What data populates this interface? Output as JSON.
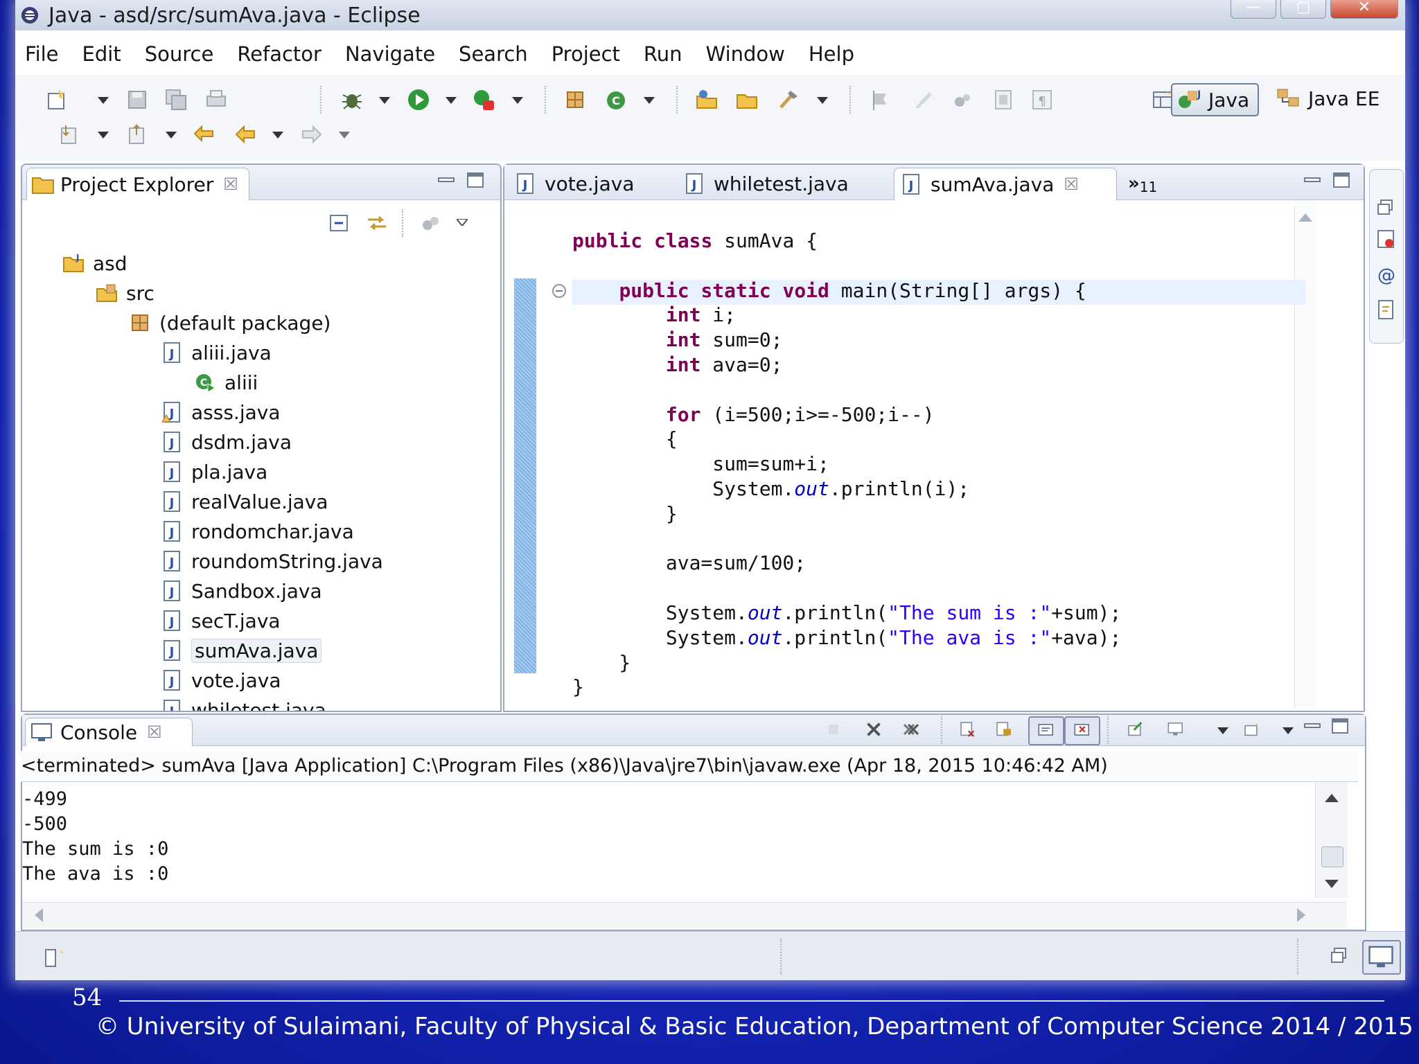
{
  "window": {
    "title": "Java - asd/src/sumAva.java - Eclipse",
    "controls": [
      "—",
      "▢",
      "✕"
    ]
  },
  "menu": [
    "File",
    "Edit",
    "Source",
    "Refactor",
    "Navigate",
    "Search",
    "Project",
    "Run",
    "Window",
    "Help"
  ],
  "perspectives": [
    {
      "label": "Java",
      "active": true,
      "icon": "java-perspective-icon"
    },
    {
      "label": "Java EE",
      "active": false,
      "icon": "javaee-perspective-icon"
    }
  ],
  "explorer": {
    "title": "Project Explorer",
    "close": "☒",
    "tree": [
      {
        "label": "asd",
        "icon": "project-icon",
        "level": 0
      },
      {
        "label": "src",
        "icon": "source-folder-icon",
        "level": 1
      },
      {
        "label": "(default package)",
        "icon": "package-icon",
        "level": 2
      },
      {
        "label": "aliii.java",
        "icon": "java-file-icon",
        "level": 3
      },
      {
        "label": "aliii",
        "icon": "class-run-icon",
        "level": 4
      },
      {
        "label": "asss.java",
        "icon": "java-file-warning-icon",
        "level": 3
      },
      {
        "label": "dsdm.java",
        "icon": "java-file-icon",
        "level": 3
      },
      {
        "label": "pla.java",
        "icon": "java-file-icon",
        "level": 3
      },
      {
        "label": "realValue.java",
        "icon": "java-file-icon",
        "level": 3
      },
      {
        "label": "rondomchar.java",
        "icon": "java-file-icon",
        "level": 3
      },
      {
        "label": "roundomString.java",
        "icon": "java-file-icon",
        "level": 3
      },
      {
        "label": "Sandbox.java",
        "icon": "java-file-icon",
        "level": 3
      },
      {
        "label": "secT.java",
        "icon": "java-file-icon",
        "level": 3
      },
      {
        "label": "sumAva.java",
        "icon": "java-file-icon",
        "level": 3,
        "selected": true
      },
      {
        "label": "vote.java",
        "icon": "java-file-icon",
        "level": 3
      },
      {
        "label": "whiletest.java",
        "icon": "java-file-icon",
        "level": 3
      }
    ]
  },
  "editor": {
    "tabs": [
      {
        "label": "vote.java",
        "active": false
      },
      {
        "label": "whiletest.java",
        "active": false
      },
      {
        "label": "sumAva.java",
        "active": true
      }
    ],
    "close": "☒",
    "overflow_label": "»",
    "overflow_count": "11",
    "code": [
      "public class sumAva {",
      "",
      "    public static void main(String[] args) {",
      "        int i;",
      "        int sum=0;",
      "        int ava=0;",
      "",
      "        for (i=500;i>=-500;i--)",
      "        {",
      "            sum=sum+i;",
      "            System.out.println(i);",
      "        }",
      "",
      "        ava=sum/100;",
      "",
      "        System.out.println(\"The sum is :\"+sum);",
      "        System.out.println(\"The ava is :\"+ava);",
      "    }",
      "}"
    ]
  },
  "console": {
    "title": "Console",
    "close": "☒",
    "status": "<terminated> sumAva [Java Application] C:\\Program Files (x86)\\Java\\jre7\\bin\\javaw.exe (Apr 18, 2015 10:46:42 AM)",
    "output": [
      "-499",
      "-500",
      "The sum is :0",
      "The ava is :0"
    ]
  },
  "footer": {
    "page_number": "54",
    "text": "© University of Sulaimani, Faculty of Physical & Basic Education, Department of Computer Science  2014 / 2015"
  },
  "colors": {
    "keyword": "#7f0055",
    "string": "#2a00ff",
    "field": "#0000c0",
    "slide_background": "#1426b8"
  }
}
